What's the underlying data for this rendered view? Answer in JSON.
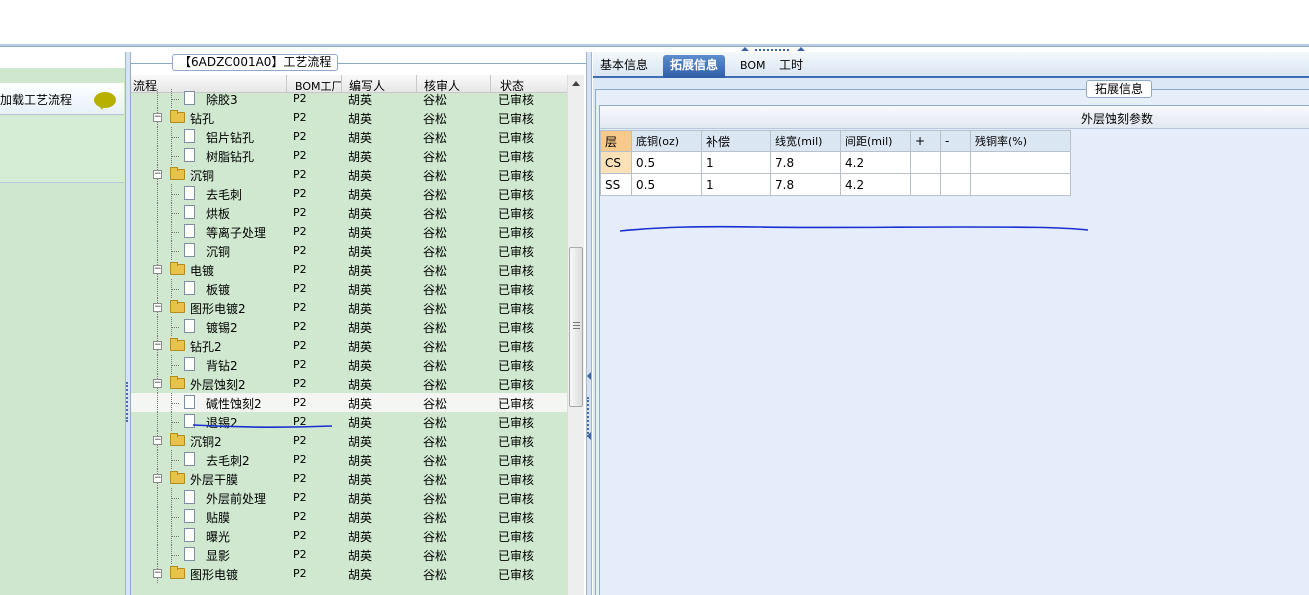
{
  "left_panel": {
    "item_label": "加载工艺流程"
  },
  "process_group": {
    "title": "【6ADZC001A0】工艺流程",
    "columns": [
      "流程",
      "BOM工厂",
      "编写人",
      "核审人",
      "状态"
    ],
    "rows": [
      {
        "level": 2,
        "type": "leaf",
        "name": "除胶3",
        "bom": "P2",
        "writer": "胡英",
        "reviewer": "谷松",
        "status": "已审核"
      },
      {
        "level": 1,
        "type": "folder",
        "name": "钻孔",
        "bom": "P2",
        "writer": "胡英",
        "reviewer": "谷松",
        "status": "已审核"
      },
      {
        "level": 2,
        "type": "leaf",
        "name": "铝片钻孔",
        "bom": "P2",
        "writer": "胡英",
        "reviewer": "谷松",
        "status": "已审核"
      },
      {
        "level": 2,
        "type": "leaf",
        "name": "树脂钻孔",
        "bom": "P2",
        "writer": "胡英",
        "reviewer": "谷松",
        "status": "已审核"
      },
      {
        "level": 1,
        "type": "folder",
        "name": "沉铜",
        "bom": "P2",
        "writer": "胡英",
        "reviewer": "谷松",
        "status": "已审核"
      },
      {
        "level": 2,
        "type": "leaf",
        "name": "去毛刺",
        "bom": "P2",
        "writer": "胡英",
        "reviewer": "谷松",
        "status": "已审核"
      },
      {
        "level": 2,
        "type": "leaf",
        "name": "烘板",
        "bom": "P2",
        "writer": "胡英",
        "reviewer": "谷松",
        "status": "已审核"
      },
      {
        "level": 2,
        "type": "leaf",
        "name": "等离子处理",
        "bom": "P2",
        "writer": "胡英",
        "reviewer": "谷松",
        "status": "已审核"
      },
      {
        "level": 2,
        "type": "leaf",
        "name": "沉铜",
        "bom": "P2",
        "writer": "胡英",
        "reviewer": "谷松",
        "status": "已审核"
      },
      {
        "level": 1,
        "type": "folder",
        "name": "电镀",
        "bom": "P2",
        "writer": "胡英",
        "reviewer": "谷松",
        "status": "已审核"
      },
      {
        "level": 2,
        "type": "leaf",
        "name": "板镀",
        "bom": "P2",
        "writer": "胡英",
        "reviewer": "谷松",
        "status": "已审核"
      },
      {
        "level": 1,
        "type": "folder",
        "name": "图形电镀2",
        "bom": "P2",
        "writer": "胡英",
        "reviewer": "谷松",
        "status": "已审核"
      },
      {
        "level": 2,
        "type": "leaf",
        "name": "镀锡2",
        "bom": "P2",
        "writer": "胡英",
        "reviewer": "谷松",
        "status": "已审核"
      },
      {
        "level": 1,
        "type": "folder",
        "name": "钻孔2",
        "bom": "P2",
        "writer": "胡英",
        "reviewer": "谷松",
        "status": "已审核"
      },
      {
        "level": 2,
        "type": "leaf",
        "name": "背钻2",
        "bom": "P2",
        "writer": "胡英",
        "reviewer": "谷松",
        "status": "已审核"
      },
      {
        "level": 1,
        "type": "folder",
        "name": "外层蚀刻2",
        "bom": "P2",
        "writer": "胡英",
        "reviewer": "谷松",
        "status": "已审核"
      },
      {
        "level": 2,
        "type": "leaf",
        "name": "碱性蚀刻2",
        "bom": "P2",
        "writer": "胡英",
        "reviewer": "谷松",
        "status": "已审核",
        "selected": true
      },
      {
        "level": 2,
        "type": "leaf",
        "name": "退锡2",
        "bom": "P2",
        "writer": "胡英",
        "reviewer": "谷松",
        "status": "已审核"
      },
      {
        "level": 1,
        "type": "folder",
        "name": "沉铜2",
        "bom": "P2",
        "writer": "胡英",
        "reviewer": "谷松",
        "status": "已审核"
      },
      {
        "level": 2,
        "type": "leaf",
        "name": "去毛刺2",
        "bom": "P2",
        "writer": "胡英",
        "reviewer": "谷松",
        "status": "已审核"
      },
      {
        "level": 1,
        "type": "folder",
        "name": "外层干膜",
        "bom": "P2",
        "writer": "胡英",
        "reviewer": "谷松",
        "status": "已审核"
      },
      {
        "level": 2,
        "type": "leaf",
        "name": "外层前处理",
        "bom": "P2",
        "writer": "胡英",
        "reviewer": "谷松",
        "status": "已审核"
      },
      {
        "level": 2,
        "type": "leaf",
        "name": "贴膜",
        "bom": "P2",
        "writer": "胡英",
        "reviewer": "谷松",
        "status": "已审核"
      },
      {
        "level": 2,
        "type": "leaf",
        "name": "曝光",
        "bom": "P2",
        "writer": "胡英",
        "reviewer": "谷松",
        "status": "已审核"
      },
      {
        "level": 2,
        "type": "leaf",
        "name": "显影",
        "bom": "P2",
        "writer": "胡英",
        "reviewer": "谷松",
        "status": "已审核"
      },
      {
        "level": 1,
        "type": "folder",
        "name": "图形电镀",
        "bom": "P2",
        "writer": "胡英",
        "reviewer": "谷松",
        "status": "已审核"
      }
    ]
  },
  "tabs": [
    {
      "label": "基本信息",
      "active": false
    },
    {
      "label": "拓展信息",
      "active": true
    },
    {
      "label": "BOM",
      "active": false
    },
    {
      "label": "工时",
      "active": false
    }
  ],
  "extension": {
    "group_title": "拓展信息",
    "section_title": "外层蚀刻参数",
    "table": {
      "headers": [
        "层",
        "底铜(oz)",
        "补偿",
        "线宽(mil)",
        "间距(mil)",
        "+",
        "-",
        "残铜率(%)"
      ],
      "rows": [
        [
          "CS",
          "0.5",
          "1",
          "7.8",
          "4.2",
          "",
          "",
          ""
        ],
        [
          "SS",
          "0.5",
          "1",
          "7.8",
          "4.2",
          "",
          "",
          ""
        ]
      ]
    }
  },
  "colors": {
    "tree_bg": "#cfe8cf",
    "tab_active": "#2f5ea6",
    "annotation_line": "#1a2fd0"
  }
}
